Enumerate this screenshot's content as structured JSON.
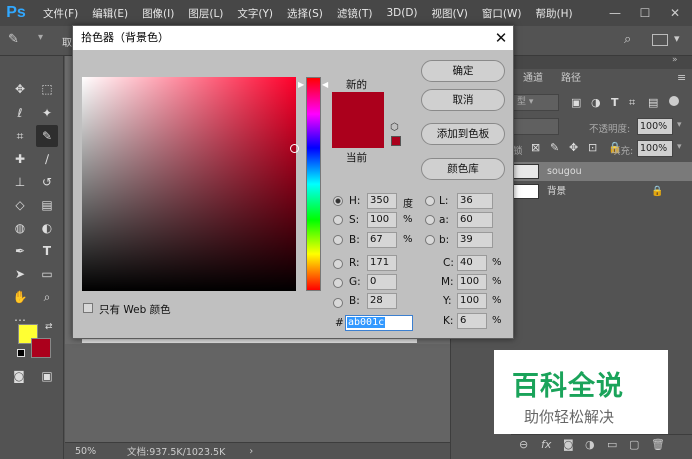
{
  "app": {
    "logo": "Ps"
  },
  "menu": [
    "文件(F)",
    "编辑(E)",
    "图像(I)",
    "图层(L)",
    "文字(Y)",
    "选择(S)",
    "滤镜(T)",
    "3D(D)",
    "视图(V)",
    "窗口(W)",
    "帮助(H)"
  ],
  "optbar": {
    "fragment": "取"
  },
  "dialog": {
    "title": "拾色器（背景色）",
    "close": "✕",
    "new_label": "新的",
    "current_label": "当前",
    "new_color": "#ab001c",
    "current_color": "#ab001c",
    "buttons": {
      "ok": "确定",
      "cancel": "取消",
      "add_swatch": "添加到色板",
      "color_lib": "颜色库"
    },
    "web_only": "只有 Web 颜色",
    "fields": {
      "H": {
        "label": "H:",
        "value": "350",
        "unit": "度"
      },
      "S": {
        "label": "S:",
        "value": "100",
        "unit": "%"
      },
      "B": {
        "label": "B:",
        "value": "67",
        "unit": "%"
      },
      "R": {
        "label": "R:",
        "value": "171"
      },
      "G": {
        "label": "G:",
        "value": "0"
      },
      "Bb": {
        "label": "B:",
        "value": "28"
      },
      "L": {
        "label": "L:",
        "value": "36"
      },
      "a": {
        "label": "a:",
        "value": "60"
      },
      "b": {
        "label": "b:",
        "value": "39"
      },
      "C": {
        "label": "C:",
        "value": "40",
        "unit": "%"
      },
      "M": {
        "label": "M:",
        "value": "100",
        "unit": "%"
      },
      "Y": {
        "label": "Y:",
        "value": "100",
        "unit": "%"
      },
      "K": {
        "label": "K:",
        "value": "6",
        "unit": "%"
      }
    },
    "hash": "#",
    "hex": "ab001c"
  },
  "status": {
    "zoom": "50%",
    "doc": "文档:937.5K/1023.5K",
    "arrow": "›"
  },
  "panel": {
    "tabs": [
      "通道",
      "路径"
    ],
    "kind_fragment": "型",
    "opacity_label": "不透明度:",
    "opacity": "100%",
    "fill_label": "填充:",
    "fill": "100%",
    "lock_fragment": "锁"
  },
  "layers": [
    {
      "name": "sougou"
    },
    {
      "name": "背景"
    }
  ],
  "watermark": {
    "title": "百科全说",
    "subtitle": "助你轻松解决"
  },
  "colors": {
    "foreground": "#ffff33",
    "background": "#ab001c"
  }
}
